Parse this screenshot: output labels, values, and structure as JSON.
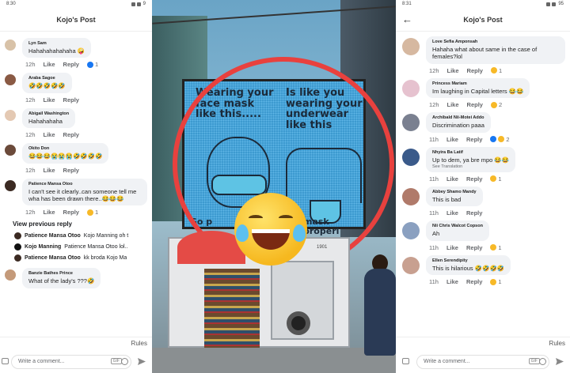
{
  "left_panel": {
    "status": {
      "time": "8:30",
      "battery": "9"
    },
    "header": {
      "title": "Kojo's Post"
    },
    "comments": [
      {
        "name": "Lyn Sam",
        "text": "Hahahahahahaha 🤪",
        "time": "12h",
        "like": "Like",
        "reply": "Reply",
        "reaction_count": "1"
      },
      {
        "name": "Araba Sagoe",
        "text": "🤣🤣🤣🤣🤣",
        "time": "12h",
        "like": "Like",
        "reply": "Reply"
      },
      {
        "name": "Abigail Washington",
        "text": "Hahahahaha",
        "time": "12h",
        "like": "Like",
        "reply": "Reply"
      },
      {
        "name": "Okito Don",
        "text": "😂😂😂😭😭😭🤣🤣🤣🤣",
        "time": "12h",
        "like": "Like",
        "reply": "Reply"
      },
      {
        "name": "Patience Mansa Otoo",
        "text": "I can't see it clearly..can someone tell me wha has been drawn there..😂😂😂",
        "time": "12h",
        "like": "Like",
        "reply": "Reply",
        "reaction_count": "1"
      }
    ],
    "view_previous": "View previous reply",
    "replies": [
      {
        "name": "Patience Mansa Otoo",
        "text": "Kojo Manning oh t"
      },
      {
        "name": "Kojo Manning",
        "text": "Patience Mansa Otoo lol.."
      },
      {
        "name": "Patience Mansa Otoo",
        "text": "kk broda Kojo Ma"
      }
    ],
    "last_comment": {
      "name": "Banzie Bathes Prince",
      "text": "What of the lady's ???🤣"
    },
    "footer": {
      "rules": "Rules",
      "placeholder": "Write a comment...",
      "gif": "GIF"
    }
  },
  "photo": {
    "billboard_left_text": "Wearing your face mask like this.....",
    "billboard_right_text": "Is like you wearing your underwear like this",
    "billboard_bottom_left": "So p",
    "billboard_bottom_right": "mask properl",
    "truck_number": "1901"
  },
  "right_panel": {
    "status": {
      "time": "8:31",
      "battery": "95"
    },
    "header": {
      "title": "Kojo's Post",
      "back": "←"
    },
    "comments": [
      {
        "name": "Love Sefia Amponsah",
        "text": "Hahaha what about same in the case of females?lol",
        "time": "12h",
        "like": "Like",
        "reply": "Reply",
        "reaction_count": "1"
      },
      {
        "name": "Princess Mariam",
        "text": "Im laughing in Capital letters 😂😂",
        "time": "12h",
        "like": "Like",
        "reply": "Reply",
        "reaction_count": "2"
      },
      {
        "name": "Archibald Nii-Motei Addo",
        "text": "Discrimination paaa",
        "time": "11h",
        "like": "Like",
        "reply": "Reply",
        "reaction_count": "2"
      },
      {
        "name": "Nhyira Ba Latif",
        "text": "Up to dem, ya bre mpo 😂😂",
        "sub": "See Translation",
        "time": "11h",
        "like": "Like",
        "reply": "Reply",
        "reaction_count": "1"
      },
      {
        "name": "Abbey Shamo Mandy",
        "text": "This is bad",
        "time": "11h",
        "like": "Like",
        "reply": "Reply"
      },
      {
        "name": "Nii Chris Walcot Copson",
        "text": "Ah",
        "time": "11h",
        "like": "Like",
        "reply": "Reply",
        "reaction_count": "1"
      },
      {
        "name": "Ellen Serendipity",
        "text": "This is hilarious 🤣🤣🤣🤣",
        "time": "11h",
        "like": "Like",
        "reply": "Reply",
        "reaction_count": "1"
      }
    ],
    "footer": {
      "rules": "Rules",
      "placeholder": "Write a comment...",
      "gif": "GIF"
    }
  },
  "colors": {
    "accent_red": "#e8413e",
    "like_blue": "#1877f2",
    "bubble": "#f0f2f5"
  },
  "icons": [
    "back-arrow-icon",
    "camera-icon",
    "gif-icon",
    "emoji-icon",
    "send-icon",
    "laughing-emoji-icon"
  ]
}
